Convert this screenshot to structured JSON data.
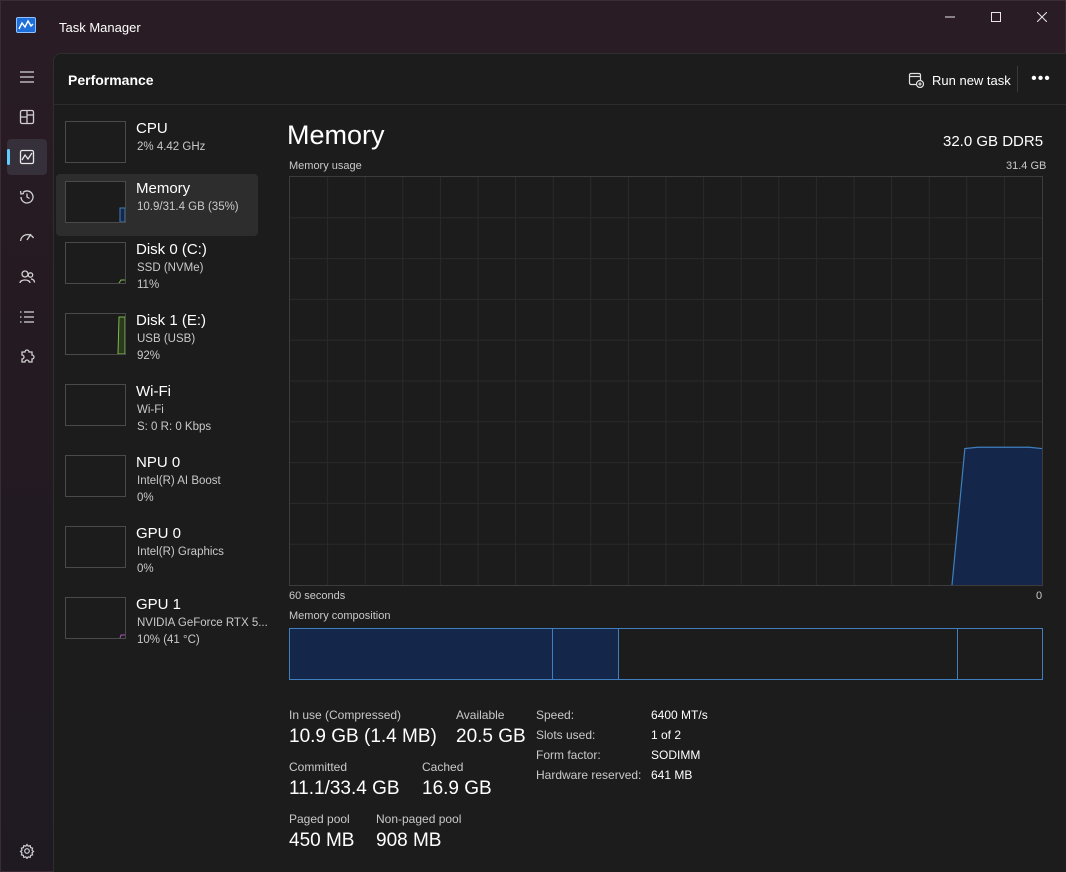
{
  "window": {
    "title": "Task Manager",
    "minimize_icon": "minimize-icon",
    "maximize_icon": "maximize-icon",
    "close_icon": "close-icon"
  },
  "colors": {
    "accent": "#60cdff",
    "memory_line": "#3f7fbf",
    "memory_fill": "#14274a",
    "disk_line": "#7ab848",
    "gpu_line": "#b050c0"
  },
  "nav": {
    "items": [
      {
        "name": "menu",
        "icon": "hamburger-icon"
      },
      {
        "name": "processes",
        "icon": "processes-icon"
      },
      {
        "name": "performance",
        "icon": "performance-icon",
        "active": true
      },
      {
        "name": "app-history",
        "icon": "history-icon"
      },
      {
        "name": "startup-apps",
        "icon": "speedometer-icon"
      },
      {
        "name": "users",
        "icon": "users-icon"
      },
      {
        "name": "details",
        "icon": "list-icon"
      },
      {
        "name": "services",
        "icon": "puzzle-icon"
      }
    ],
    "settings_icon": "gear-icon"
  },
  "header": {
    "title": "Performance",
    "run_new_task": "Run new task",
    "more": "•••"
  },
  "resources": [
    {
      "name": "CPU",
      "sub": "2%  4.42 GHz",
      "sub2": ""
    },
    {
      "name": "Memory",
      "sub": "10.9/31.4 GB (35%)",
      "sub2": "",
      "active": true
    },
    {
      "name": "Disk 0 (C:)",
      "sub": "SSD (NVMe)",
      "sub2": "11%"
    },
    {
      "name": "Disk 1 (E:)",
      "sub": "USB (USB)",
      "sub2": "92%"
    },
    {
      "name": "Wi-Fi",
      "sub": "Wi-Fi",
      "sub2": "S: 0  R: 0 Kbps"
    },
    {
      "name": "NPU 0",
      "sub": "Intel(R) AI Boost",
      "sub2": "0%"
    },
    {
      "name": "GPU 0",
      "sub": "Intel(R) Graphics",
      "sub2": "0%"
    },
    {
      "name": "GPU 1",
      "sub": "NVIDIA GeForce RTX 5...",
      "sub2": "10% (41 °C)"
    }
  ],
  "memory": {
    "title": "Memory",
    "spec": "32.0 GB DDR5",
    "usage_label": "Memory usage",
    "usage_max": "31.4 GB",
    "time_left": "60 seconds",
    "time_right": "0",
    "composition_label": "Memory composition",
    "usage_history_gb": [
      0,
      10.5,
      10.6,
      10.6,
      10.6,
      10.6,
      10.6,
      10.5
    ],
    "composition_fractions": {
      "in_use": 0.35,
      "modified": 0.087,
      "standby": 0.451,
      "free": 0.112
    },
    "stats": {
      "in_use_label": "In use (Compressed)",
      "in_use_value": "10.9 GB (1.4 MB)",
      "available_label": "Available",
      "available_value": "20.5 GB",
      "committed_label": "Committed",
      "committed_value": "11.1/33.4 GB",
      "cached_label": "Cached",
      "cached_value": "16.9 GB",
      "paged_pool_label": "Paged pool",
      "paged_pool_value": "450 MB",
      "nonpaged_pool_label": "Non-paged pool",
      "nonpaged_pool_value": "908 MB"
    },
    "specs": {
      "speed_label": "Speed:",
      "speed_value": "6400 MT/s",
      "slots_label": "Slots used:",
      "slots_value": "1 of 2",
      "form_label": "Form factor:",
      "form_value": "SODIMM",
      "reserved_label": "Hardware reserved:",
      "reserved_value": "641 MB"
    }
  }
}
